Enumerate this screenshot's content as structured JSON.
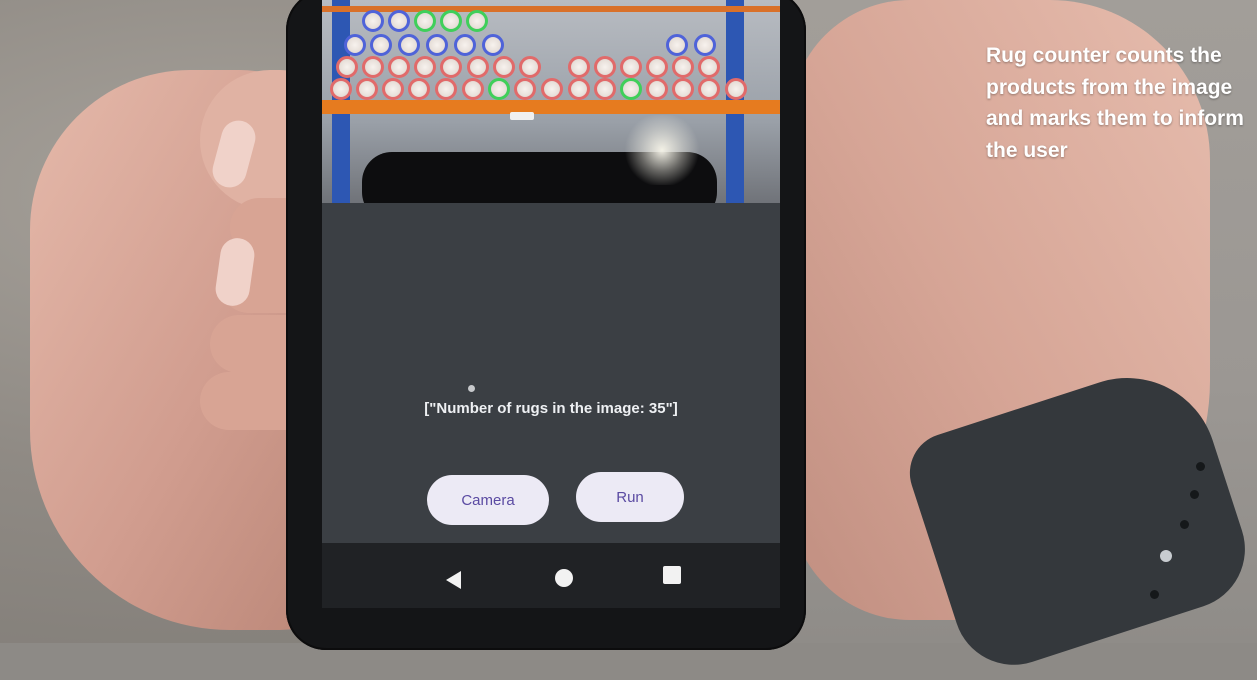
{
  "app": {
    "result_text": "[\"Number of rugs in the image: 35\"]",
    "buttons": {
      "camera_label": "Camera",
      "run_label": "Run"
    },
    "nav_icons": [
      "back-icon",
      "home-icon",
      "recent-apps-icon"
    ],
    "colors": {
      "button_bg": "#eceaf5",
      "button_text": "#5a4aa2",
      "app_bg": "#3b3f44",
      "rack_orange": "#e67b1f",
      "rack_blue": "#2d57b3",
      "marker_red": "#e16a6a",
      "marker_blue": "#4f63d9",
      "marker_green": "#3fcf5a"
    }
  },
  "caption": {
    "text": "Rug counter counts the products from the image and marks them to inform the user"
  }
}
